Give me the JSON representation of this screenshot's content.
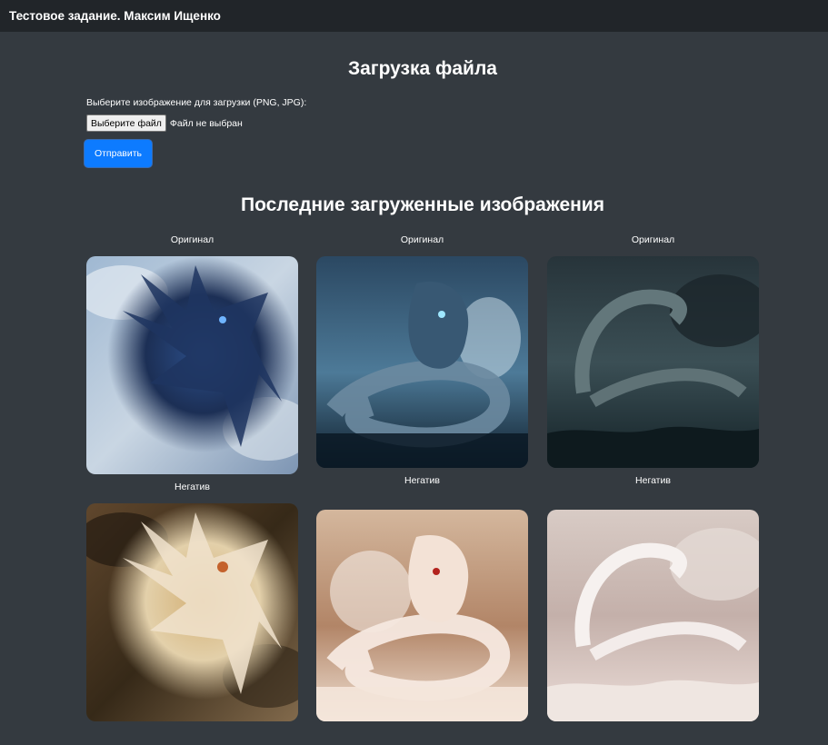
{
  "navbar": {
    "brand": "Тестовое задание. Максим Ищенко"
  },
  "upload": {
    "title": "Загрузка файла",
    "label": "Выберите изображение для загрузки (PNG, JPG):",
    "choose_button": "Выберите файл",
    "file_status": "Файл не выбран",
    "submit_button": "Отправить"
  },
  "recent": {
    "title": "Последние загруженные изображения",
    "items": [
      {
        "original_label": "Оригинал",
        "negative_label": "Негатив"
      },
      {
        "original_label": "Оригинал",
        "negative_label": "Негатив"
      },
      {
        "original_label": "Оригинал",
        "negative_label": "Негатив"
      }
    ]
  }
}
